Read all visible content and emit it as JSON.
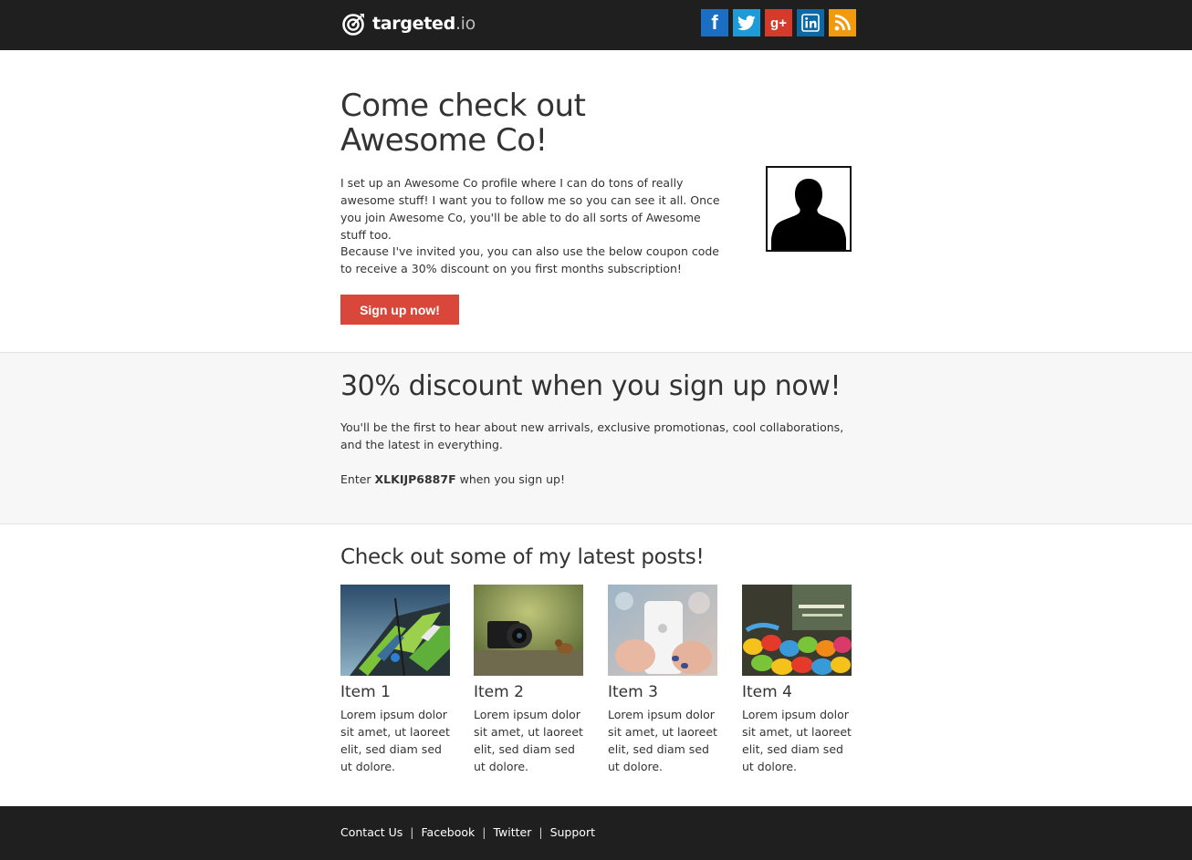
{
  "header": {
    "brand_name": "targeted",
    "brand_tld": ".io",
    "social": [
      {
        "name": "facebook",
        "glyph": "f",
        "color": "#1a6fc4"
      },
      {
        "name": "twitter",
        "glyph": "twitter-bird",
        "color": "#1d9bd8"
      },
      {
        "name": "google-plus",
        "glyph": "g+",
        "color": "#d53b2a"
      },
      {
        "name": "linkedin",
        "glyph": "in",
        "color": "#0b6aa6"
      },
      {
        "name": "rss",
        "glyph": "rss",
        "color": "#f29a0d"
      }
    ]
  },
  "hero": {
    "title_line1": "Come check out",
    "title_line2": "Awesome Co!",
    "paragraph1": "I set up an Awesome Co profile where I can do tons of really awesome stuff! I want you to follow me so you can see it all. Once you join Awesome Co, you'll be able to do all sorts of Awesome stuff too.",
    "paragraph2": "Because I've invited you, you can also use the below coupon code to receive a 30% discount on you first months subscription!",
    "signup_label": "Sign up now!",
    "avatar_icon": "person-silhouette-icon"
  },
  "discount": {
    "title": "30% discount when you sign up now!",
    "paragraph": "You'll be the first to hear about new arrivals, exclusive promotionas, cool collaborations, and the latest in everything.",
    "enter_prefix": "Enter ",
    "code": "XLKIJP6887F",
    "enter_suffix": " when you sign up!"
  },
  "posts": {
    "title": "Check out some of my latest posts!",
    "items": [
      {
        "title": "Item 1",
        "desc": "Lorem ipsum dolor sit amet, ut laoreet elit, sed diam sed ut dolore."
      },
      {
        "title": "Item 2",
        "desc": "Lorem ipsum dolor sit amet, ut laoreet elit, sed diam sed ut dolore."
      },
      {
        "title": "Item 3",
        "desc": "Lorem ipsum dolor sit amet, ut laoreet elit, sed diam sed ut dolore."
      },
      {
        "title": "Item 4",
        "desc": "Lorem ipsum dolor sit amet, ut laoreet elit, sed diam sed ut dolore."
      }
    ]
  },
  "footer": {
    "links": [
      "Contact Us",
      "Facebook",
      "Twitter",
      "Support"
    ],
    "separator": "|"
  }
}
